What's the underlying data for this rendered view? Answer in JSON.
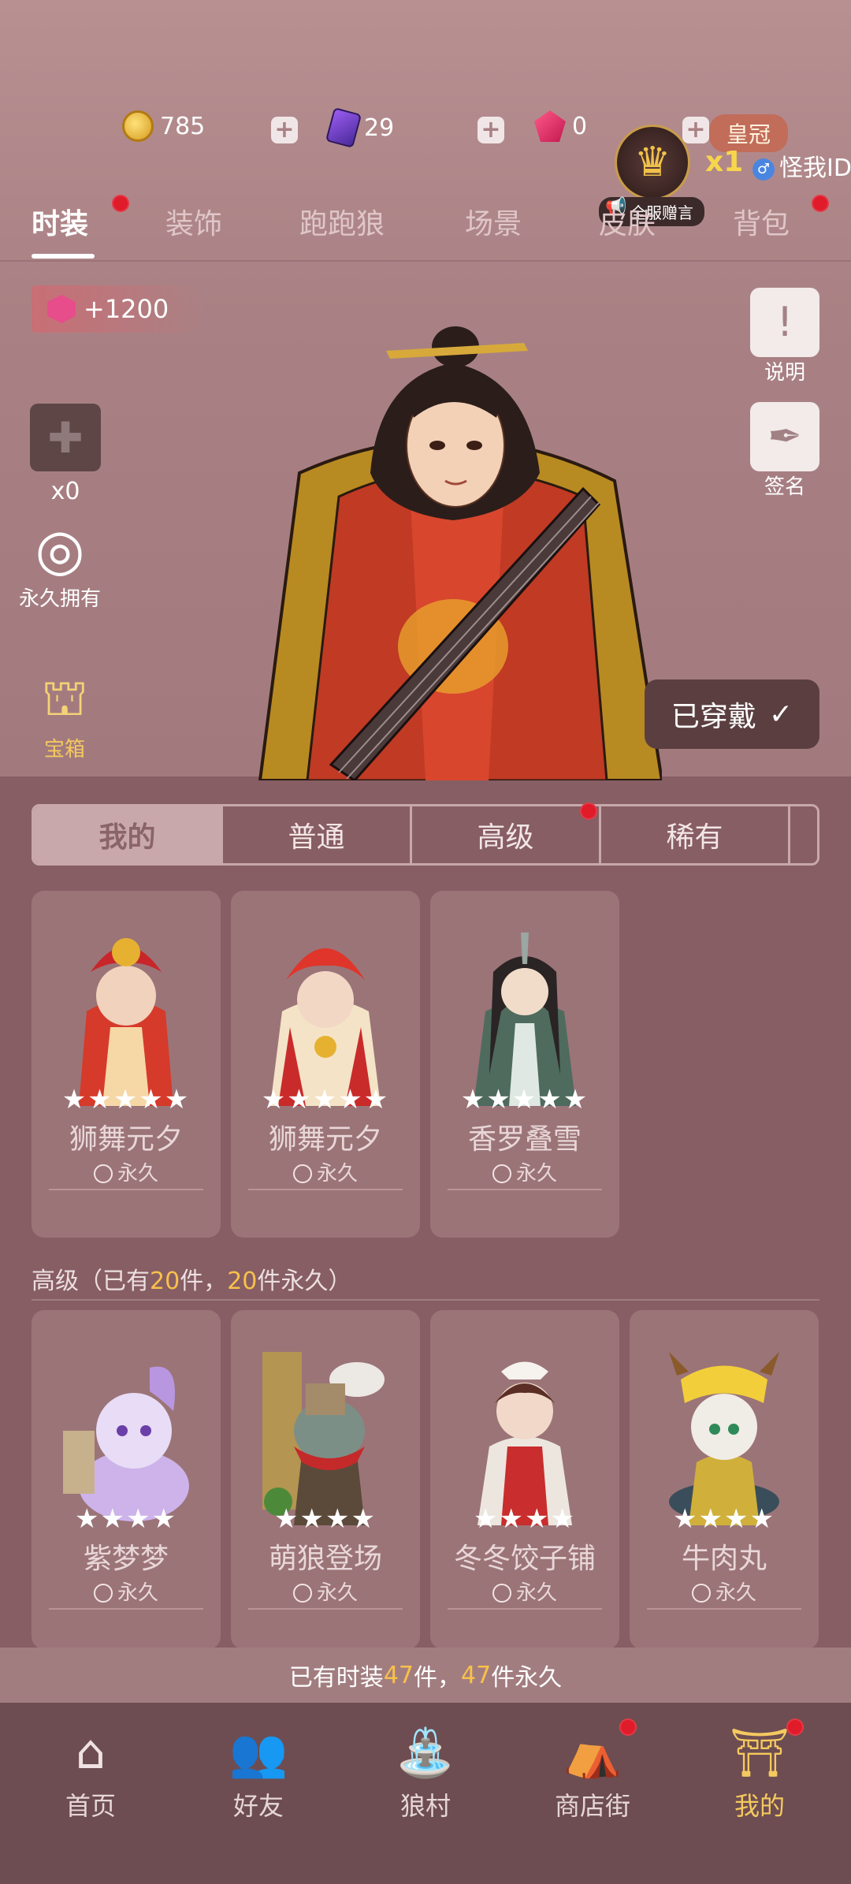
{
  "currency": {
    "coins": "785",
    "cards": "29",
    "gems": "0"
  },
  "crown": {
    "title": "皇冠",
    "count": "x1",
    "user": "怪我ID",
    "tag": "全服赠言"
  },
  "tabs": [
    {
      "label": "时装",
      "active": true
    },
    {
      "label": "装饰"
    },
    {
      "label": "跑跑狼"
    },
    {
      "label": "场景"
    },
    {
      "label": "皮肤"
    },
    {
      "label": "背包"
    }
  ],
  "score_badge": "+1200",
  "left": {
    "puzzle_count": "x0",
    "permanent_label": "永久拥有",
    "chest_label": "宝箱"
  },
  "right": {
    "manual_label": "说明",
    "sign_label": "签名"
  },
  "worn_button": "已穿戴",
  "subtabs": [
    {
      "label": "我的",
      "active": true
    },
    {
      "label": "普通"
    },
    {
      "label": "高级"
    },
    {
      "label": "稀有"
    }
  ],
  "my_cards": [
    {
      "name": "狮舞元夕",
      "stars": "★★★★★",
      "perm": "永久"
    },
    {
      "name": "狮舞元夕",
      "stars": "★★★★★",
      "perm": "永久"
    },
    {
      "name": "香罗叠雪",
      "stars": "★★★★★",
      "perm": "永久"
    }
  ],
  "section": {
    "prefix": "高级（已有",
    "count1": "20",
    "mid": "件，",
    "count2": "20",
    "suffix": "件永久）"
  },
  "adv_cards": [
    {
      "name": "紫梦梦",
      "stars": "★★★★",
      "perm": "永久"
    },
    {
      "name": "萌狼登场",
      "stars": "★★★★",
      "perm": "永久"
    },
    {
      "name": "冬冬饺子铺",
      "stars": "★★★★",
      "perm": "永久"
    },
    {
      "name": "牛肉丸",
      "stars": "★★★★",
      "perm": "永久"
    }
  ],
  "summary": {
    "prefix": "已有时装",
    "count1": "47",
    "mid": "件，",
    "count2": "47",
    "suffix": "件永久"
  },
  "nav": [
    {
      "label": "首页"
    },
    {
      "label": "好友"
    },
    {
      "label": "狼村"
    },
    {
      "label": "商店街"
    },
    {
      "label": "我的",
      "active": true
    }
  ]
}
